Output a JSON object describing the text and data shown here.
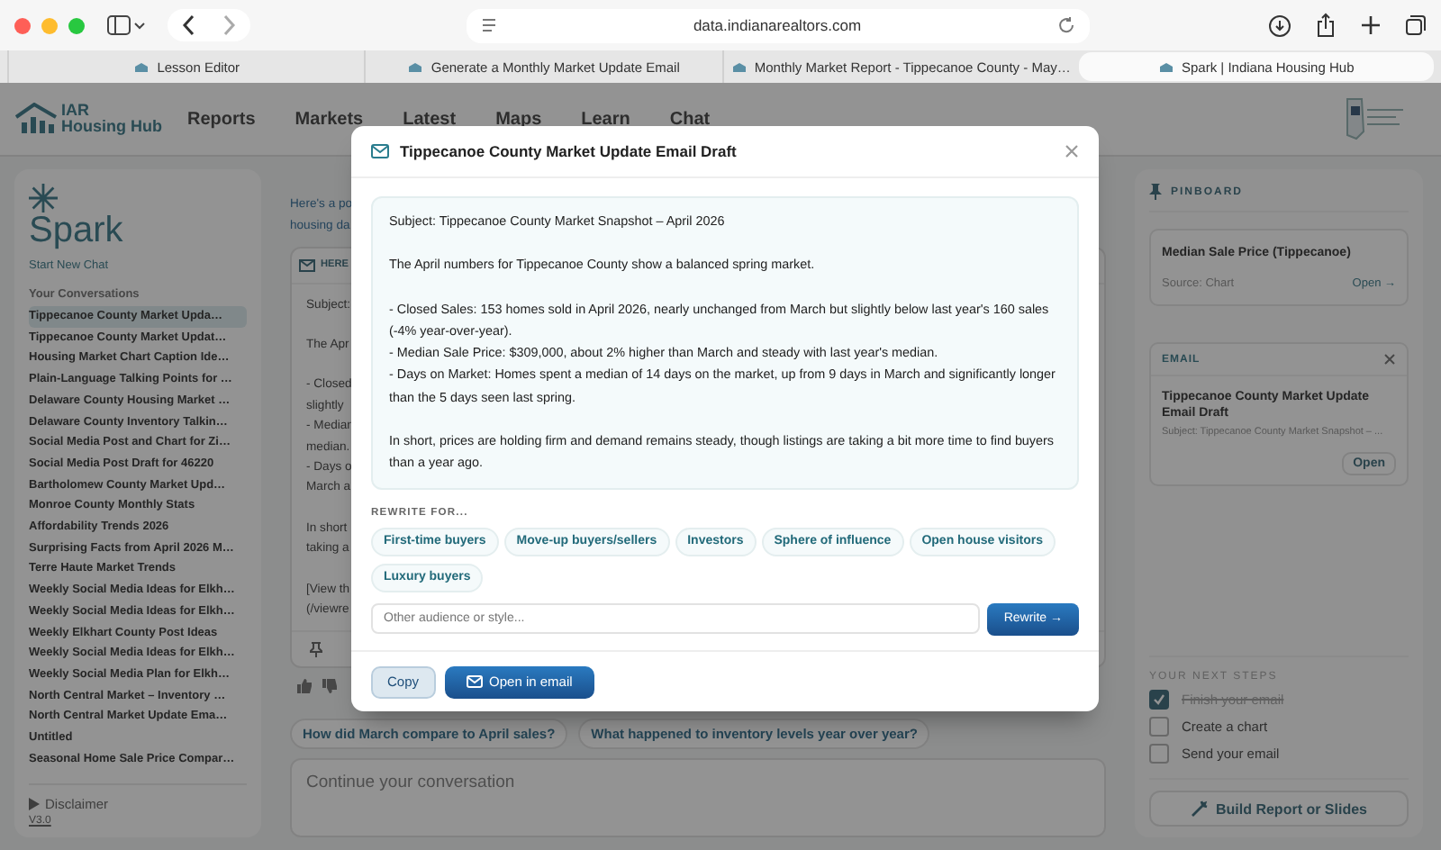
{
  "browser": {
    "url": "data.indianarealtors.com",
    "tabs": [
      {
        "label": "Lesson Editor",
        "selected": false
      },
      {
        "label": "Generate a Monthly Market Update Email",
        "selected": false
      },
      {
        "label": "Monthly Market Report - Tippecanoe County - May…",
        "selected": false
      },
      {
        "label": "Spark | Indiana Housing Hub",
        "selected": true
      }
    ]
  },
  "header": {
    "brand": [
      "IAR",
      "Housing Hub"
    ],
    "nav": [
      "Reports",
      "Markets",
      "Latest",
      "Maps",
      "Learn",
      "Chat"
    ]
  },
  "sidebar": {
    "title": "Spark",
    "new_chat": "Start New Chat",
    "section": "Your Conversations",
    "conversations": [
      {
        "label": "Tippecanoe County Market Upda…",
        "selected": true
      },
      {
        "label": "Tippecanoe County Market Updat…",
        "selected": false
      },
      {
        "label": "Housing Market Chart Caption Ide…",
        "selected": false
      },
      {
        "label": "Plain-Language Talking Points for …",
        "selected": false
      },
      {
        "label": "Delaware County Housing Market …",
        "selected": false
      },
      {
        "label": "Delaware County Inventory Talkin…",
        "selected": false
      },
      {
        "label": "Social Media Post and Chart for Zi…",
        "selected": false
      },
      {
        "label": "Social Media Post Draft for 46220",
        "selected": false
      },
      {
        "label": "Bartholomew County Market Upd…",
        "selected": false
      },
      {
        "label": "Monroe County Monthly Stats",
        "selected": false
      },
      {
        "label": "Affordability Trends 2026",
        "selected": false
      },
      {
        "label": "Surprising Facts from April 2026 M…",
        "selected": false
      },
      {
        "label": "Terre Haute Market Trends",
        "selected": false
      },
      {
        "label": "Weekly Social Media Ideas for Elkh…",
        "selected": false
      },
      {
        "label": "Weekly Social Media Ideas for Elkh…",
        "selected": false
      },
      {
        "label": "Weekly Elkhart County Post Ideas",
        "selected": false
      },
      {
        "label": "Weekly Social Media Ideas for Elkh…",
        "selected": false
      },
      {
        "label": "Weekly Social Media Plan for Elkh…",
        "selected": false
      },
      {
        "label": "North Central Market – Inventory …",
        "selected": false
      },
      {
        "label": "North Central Market Update Ema…",
        "selected": false
      },
      {
        "label": "Untitled",
        "selected": false
      },
      {
        "label": "Seasonal Home Sale Price Compar…",
        "selected": false
      }
    ],
    "disclaimer": "Disclaimer",
    "version": "V3.0"
  },
  "chat": {
    "intro": [
      "Here's a po",
      "housing da"
    ],
    "card_header": "HERE",
    "card_paragraphs": [
      [
        "Subject:"
      ],
      [
        "The Apr"
      ],
      [
        "- Closed",
        "slightly",
        "- Median",
        "median.",
        "- Days o",
        "March a"
      ],
      [
        "In short",
        "taking a"
      ],
      [
        "[View th",
        "(/viewre"
      ]
    ],
    "suggestions": [
      "How did March compare to April sales?",
      "What happened to inventory levels year over year?"
    ],
    "input_placeholder": "Continue your conversation"
  },
  "pinboard": {
    "title": "PINBOARD",
    "chart_card": {
      "title": "Median Sale Price (Tippecanoe)",
      "source": "Source: Chart",
      "open": "Open →"
    },
    "email_card": {
      "tag": "EMAIL",
      "title": "Tippecanoe County Market Update Email Draft",
      "subject": "Subject: Tippecanoe County Market Snapshot – ...",
      "open": "Open"
    }
  },
  "next_steps": {
    "title": "YOUR NEXT STEPS",
    "items": [
      {
        "label": "Finish your email",
        "checked": true
      },
      {
        "label": "Create a chart",
        "checked": false
      },
      {
        "label": "Send your email",
        "checked": false
      }
    ]
  },
  "build_button": "Build Report or Slides",
  "modal": {
    "title": "Tippecanoe County Market Update Email Draft",
    "paragraphs": [
      [
        "Subject: Tippecanoe County Market Snapshot – April 2026"
      ],
      [
        "The April numbers for Tippecanoe County show a balanced spring market."
      ],
      [
        "- Closed Sales: 153 homes sold in April 2026, nearly unchanged from March but slightly below last year's 160 sales (-4% year-over-year).",
        "- Median Sale Price: $309,000, about 2% higher than March and steady with last year's median.",
        "- Days on Market: Homes spent a median of 14 days on the market, up from 9 days in March and significantly longer than the 5 days seen last spring."
      ],
      [
        "In short, prices are holding firm and demand remains steady, though listings are taking a bit more time to find buyers than a year ago."
      ]
    ],
    "rewrite_label": "REWRITE FOR...",
    "audiences": [
      "First-time buyers",
      "Move-up buyers/sellers",
      "Investors",
      "Sphere of influence",
      "Open house visitors",
      "Luxury buyers"
    ],
    "placeholder": "Other audience or style...",
    "rewrite_button": "Rewrite →",
    "copy_button": "Copy",
    "open_button": "Open in email"
  }
}
